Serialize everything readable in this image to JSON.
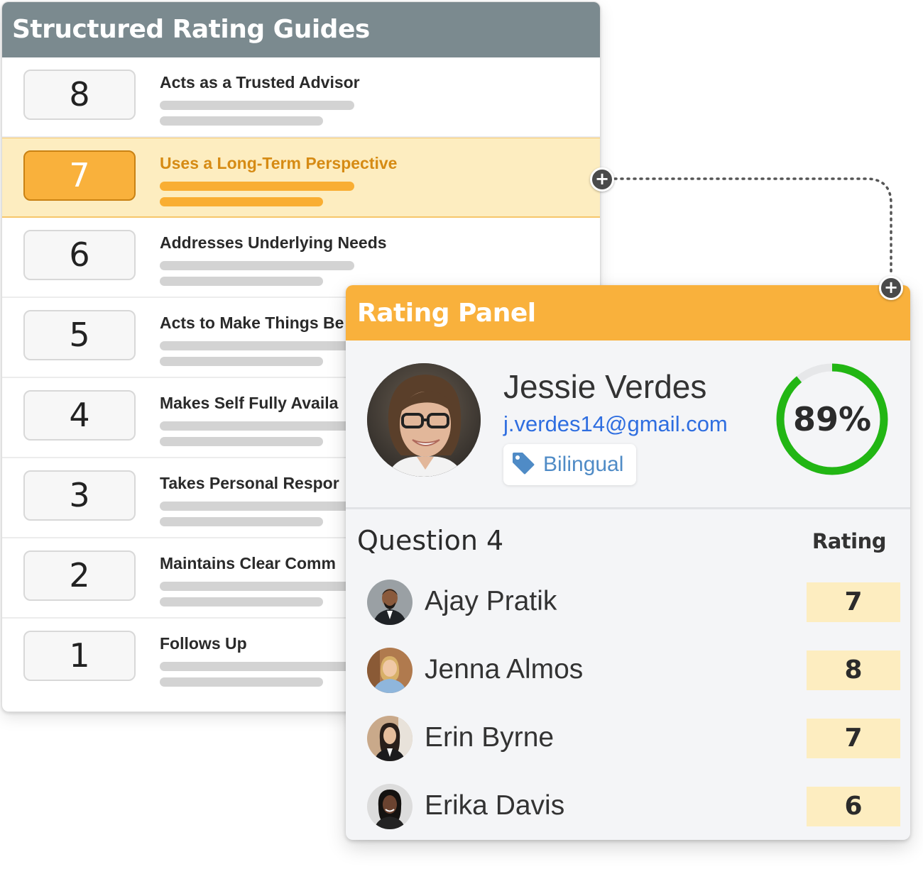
{
  "guides": {
    "title": "Structured Rating Guides",
    "items": [
      {
        "number": "8",
        "label": "Acts as a Trusted Advisor"
      },
      {
        "number": "7",
        "label": "Uses a Long-Term Perspective"
      },
      {
        "number": "6",
        "label": "Addresses Underlying Needs"
      },
      {
        "number": "5",
        "label": "Acts to Make Things Be"
      },
      {
        "number": "4",
        "label": "Makes Self Fully Availa"
      },
      {
        "number": "3",
        "label": "Takes Personal Respor"
      },
      {
        "number": "2",
        "label": "Maintains Clear Comm"
      },
      {
        "number": "1",
        "label": "Follows Up"
      }
    ],
    "selected_number": "7"
  },
  "panel": {
    "title": "Rating Panel",
    "candidate": {
      "name": "Jessie Verdes",
      "email": "j.verdes14@gmail.com",
      "tag": "Bilingual",
      "score_label": "89%",
      "score_fraction": 0.89
    },
    "question": {
      "title": "Question 4",
      "rating_header": "Rating",
      "raters": [
        {
          "name": "Ajay Pratik",
          "rating": "7"
        },
        {
          "name": "Jenna Almos",
          "rating": "8"
        },
        {
          "name": "Erin Byrne",
          "rating": "7"
        },
        {
          "name": "Erika Davis",
          "rating": "6"
        }
      ]
    }
  },
  "colors": {
    "guides_header": "#7b8a8f",
    "panel_header": "#f9b13c",
    "selected_row": "#fdedc0",
    "progress": "#22b614",
    "link": "#2f6ee0",
    "tag": "#4f8bc6"
  },
  "icons": {
    "connector_node": "plus-icon",
    "tag_icon": "tag-icon"
  }
}
